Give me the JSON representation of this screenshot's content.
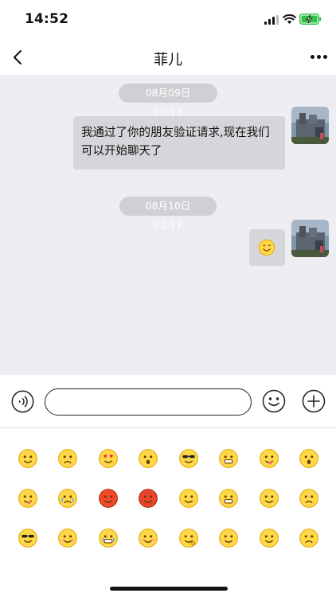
{
  "status_bar": {
    "time": "14:52"
  },
  "nav": {
    "title": "菲儿"
  },
  "chat": {
    "timestamps": [
      "08月09日 10:13",
      "08月10日 22:11"
    ],
    "messages": [
      {
        "text": "我通过了你的朋友验证请求,现在我们可以开始聊天了"
      },
      {
        "text": "smile-emoji"
      }
    ]
  },
  "input": {
    "value": "",
    "placeholder": ""
  },
  "emoji_panel": {
    "rows": [
      [
        "smile",
        "worried",
        "heart-eyes",
        "shocked",
        "cool-sunglasses",
        "grin",
        "tongue-wink",
        "surprised"
      ],
      [
        "drool",
        "crying",
        "angry-red",
        "furious",
        "sly-smile",
        "grimace",
        "thinking-question",
        "sad"
      ],
      [
        "cool-mustache",
        "blushing",
        "laughing-tears",
        "shy",
        "pondering",
        "content-smile",
        "confused",
        "frown"
      ]
    ]
  },
  "colors": {
    "chat_bg": "#ededf2",
    "bubble_bg": "#d6d6da",
    "timestamp_bg": "#d0d0d4",
    "battery_green": "#30c04a"
  }
}
